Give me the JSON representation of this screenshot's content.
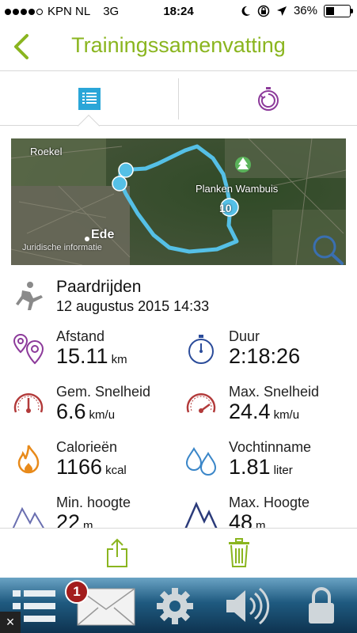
{
  "status_bar": {
    "carrier": "KPN NL",
    "network": "3G",
    "time": "18:24",
    "battery": "36%",
    "battery_level": 0.36,
    "icons": [
      "moon-icon",
      "rotation-lock-icon",
      "location-arrow-icon",
      "battery-icon"
    ]
  },
  "nav": {
    "title": "Trainingssamenvatting",
    "back_icon": "chevron-left-icon"
  },
  "tabs": [
    {
      "icon": "list-icon",
      "selected": true
    },
    {
      "icon": "stopwatch-icon",
      "selected": false
    }
  ],
  "map": {
    "labels": {
      "roekel": "Roekel",
      "planken": "Planken Wambuis",
      "ede": "Ede",
      "legal": "Juridische informatie"
    },
    "marker": "10"
  },
  "activity": {
    "name": "Paardrijden",
    "date": "12 augustus 2015 14:33"
  },
  "stats": [
    {
      "key": "distance",
      "label": "Afstand",
      "value": "15.11",
      "unit": "km",
      "icon": "map-pins-icon"
    },
    {
      "key": "duration",
      "label": "Duur",
      "value": "2:18:26",
      "unit": "",
      "icon": "stopwatch-icon"
    },
    {
      "key": "avg_speed",
      "label": "Gem. Snelheid",
      "value": "6.6",
      "unit": "km/u",
      "icon": "speedometer-icon"
    },
    {
      "key": "max_speed",
      "label": "Max. Snelheid",
      "value": "24.4",
      "unit": "km/u",
      "icon": "speedometer-icon"
    },
    {
      "key": "calories",
      "label": "Calorieën",
      "value": "1166",
      "unit": "kcal",
      "icon": "flame-icon"
    },
    {
      "key": "hydration",
      "label": "Vochtinname",
      "value": "1.81",
      "unit": "liter",
      "icon": "water-drops-icon"
    },
    {
      "key": "min_altitude",
      "label": "Min. hoogte",
      "value": "22",
      "unit": "m",
      "icon": "mountain-icon"
    },
    {
      "key": "max_altitude",
      "label": "Max. Hoogte",
      "value": "48",
      "unit": "m",
      "icon": "mountain-icon"
    }
  ],
  "actions": {
    "share_icon": "share-icon",
    "delete_icon": "trash-icon"
  },
  "dock": {
    "mail_badge": "1",
    "close": "×",
    "items": [
      "list-icon",
      "mail-icon",
      "gear-icon",
      "speaker-icon",
      "lock-icon"
    ]
  },
  "colors": {
    "accent_green": "#8ab51f",
    "tab_blue": "#2aa6d8",
    "purple": "#8c3a9a",
    "route_blue": "#55c0e6",
    "speed_red": "#b23a3a",
    "flame_orange": "#e88a1a",
    "drop_blue": "#3a86c8",
    "navy": "#2b3b7a"
  }
}
